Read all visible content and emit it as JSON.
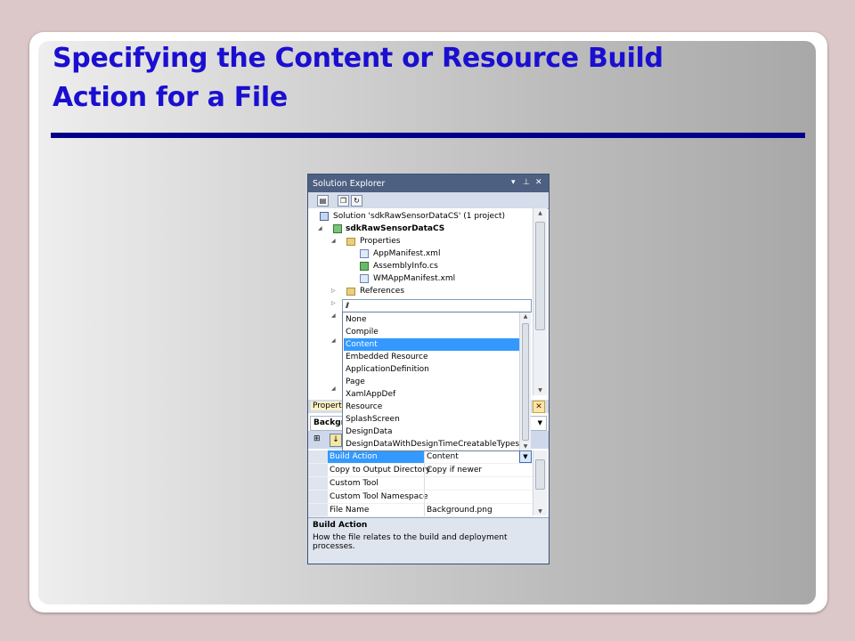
{
  "slide": {
    "title_line1": "Specifying the Content or Resource Build",
    "title_line2": "Action for a File"
  },
  "solution_explorer": {
    "title": "Solution Explorer",
    "pin_glyph": "▾ ⊣ ✕",
    "toolbar_icons": [
      "properties-icon",
      "show-all-files-icon",
      "refresh-icon"
    ],
    "tree": {
      "solution": "Solution 'sdkRawSensorDataCS' (1 project)",
      "project": "sdkRawSensorDataCS",
      "properties_folder": "Properties",
      "files": [
        "AppManifest.xml",
        "AssemblyInfo.cs",
        "WMAppManifest.xml"
      ],
      "references": "References"
    }
  },
  "build_action_dropdown": {
    "options": [
      "None",
      "Compile",
      "Content",
      "Embedded Resource",
      "ApplicationDefinition",
      "Page",
      "XamlAppDef",
      "Resource",
      "SplashScreen",
      "DesignData",
      "DesignDataWithDesignTimeCreatableTypes"
    ],
    "selected": "Content"
  },
  "properties": {
    "tab_label": "Properti",
    "object_label": "Backgr",
    "grid": [
      {
        "name": "Build Action",
        "value": "Content"
      },
      {
        "name": "Copy to Output Directory",
        "value": "Copy if newer"
      },
      {
        "name": "Custom Tool",
        "value": ""
      },
      {
        "name": "Custom Tool Namespace",
        "value": ""
      },
      {
        "name": "File Name",
        "value": "Background.png"
      }
    ],
    "description_title": "Build Action",
    "description_text": "How the file relates to the build and deployment processes."
  },
  "colors": {
    "title": "#1a0fd0",
    "rule": "#00008b",
    "selection": "#3399ff",
    "window_title": "#4d6082"
  }
}
